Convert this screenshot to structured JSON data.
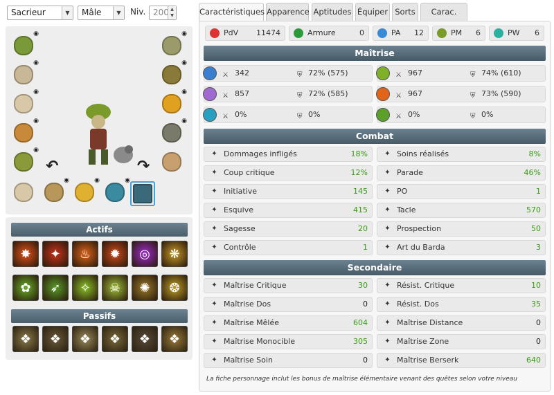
{
  "filters": {
    "class": "Sacrieur",
    "gender": "Mâle",
    "level_label": "Niv.",
    "level_value": "200"
  },
  "tabs": [
    "Caractéristiques",
    "Apparence",
    "Aptitudes",
    "Équiper",
    "Sorts",
    "Carac. Supp."
  ],
  "active_tab": "Caractéristiques",
  "top_stats": [
    {
      "label": "PdV",
      "value": "11474",
      "icon": "heart-icon",
      "color": "#d33"
    },
    {
      "label": "Armure",
      "value": "0",
      "icon": "armor-heart-icon",
      "color": "#2a9a3a"
    },
    {
      "label": "PA",
      "value": "12",
      "icon": "star-icon",
      "color": "#3a8ad8"
    },
    {
      "label": "PM",
      "value": "6",
      "icon": "boot-icon",
      "color": "#7a9a2a"
    },
    {
      "label": "PW",
      "value": "6",
      "icon": "wakfu-icon",
      "color": "#2ab0a0"
    }
  ],
  "mastery_title": "Maîtrise",
  "mastery": [
    {
      "element": "water",
      "color": "#3a7fd0",
      "mastery": "342",
      "resist": "72% (575)"
    },
    {
      "element": "earth",
      "color": "#7fb02a",
      "mastery": "967",
      "resist": "74% (610)"
    },
    {
      "element": "air",
      "color": "#a06ad0",
      "mastery": "857",
      "resist": "72% (585)"
    },
    {
      "element": "fire",
      "color": "#e0641a",
      "mastery": "967",
      "resist": "73% (590)"
    },
    {
      "element": "stasis",
      "color": "#2aa0c0",
      "mastery": "0%",
      "resist": "0%"
    },
    {
      "element": "nature",
      "color": "#5aa02a",
      "mastery": "0%",
      "resist": "0%"
    }
  ],
  "combat_title": "Combat",
  "combat": [
    {
      "label": "Dommages infligés",
      "value": "18%",
      "green": true,
      "icon": "sword-icon"
    },
    {
      "label": "Soins réalisés",
      "value": "8%",
      "green": true,
      "icon": "heal-icon"
    },
    {
      "label": "Coup critique",
      "value": "12%",
      "green": true,
      "icon": "crit-icon"
    },
    {
      "label": "Parade",
      "value": "46%",
      "green": true,
      "icon": "parry-icon"
    },
    {
      "label": "Initiative",
      "value": "145",
      "green": true,
      "icon": "initiative-icon"
    },
    {
      "label": "PO",
      "value": "1",
      "green": true,
      "icon": "range-icon"
    },
    {
      "label": "Esquive",
      "value": "415",
      "green": true,
      "icon": "dodge-icon"
    },
    {
      "label": "Tacle",
      "value": "570",
      "green": true,
      "icon": "lock-icon"
    },
    {
      "label": "Sagesse",
      "value": "20",
      "green": true,
      "icon": "wisdom-icon"
    },
    {
      "label": "Prospection",
      "value": "50",
      "green": true,
      "icon": "prospection-icon"
    },
    {
      "label": "Contrôle",
      "value": "1",
      "green": true,
      "icon": "control-icon"
    },
    {
      "label": "Art du Barda",
      "value": "3",
      "green": true,
      "icon": "bag-icon"
    }
  ],
  "secondary_title": "Secondaire",
  "secondary": [
    {
      "label": "Maîtrise Critique",
      "value": "30",
      "green": true,
      "icon": "crit-mastery-icon"
    },
    {
      "label": "Résist. Critique",
      "value": "10",
      "green": true,
      "icon": "crit-resist-icon"
    },
    {
      "label": "Maîtrise Dos",
      "value": "0",
      "green": false,
      "icon": "back-mastery-icon"
    },
    {
      "label": "Résist. Dos",
      "value": "35",
      "green": true,
      "icon": "back-resist-icon"
    },
    {
      "label": "Maîtrise Mêlée",
      "value": "604",
      "green": true,
      "icon": "melee-icon"
    },
    {
      "label": "Maîtrise Distance",
      "value": "0",
      "green": false,
      "icon": "distance-icon"
    },
    {
      "label": "Maîtrise Monocible",
      "value": "305",
      "green": true,
      "icon": "single-target-icon"
    },
    {
      "label": "Maîtrise Zone",
      "value": "0",
      "green": false,
      "icon": "area-icon"
    },
    {
      "label": "Maîtrise Soin",
      "value": "0",
      "green": false,
      "icon": "heal-mastery-icon"
    },
    {
      "label": "Maîtrise Berserk",
      "value": "640",
      "green": true,
      "icon": "berserk-icon"
    }
  ],
  "footnote": "La fiche personnage inclut les bonus de maîtrise élémentaire venant des quêtes selon votre niveau",
  "skills": {
    "active_title": "Actifs",
    "passive_title": "Passifs",
    "active_colors": [
      "#e0521a",
      "#c8321a",
      "#e0641a",
      "#d04a1a",
      "#a02ad0",
      "#c89a2a",
      "#6ab02a",
      "#5a9a2a",
      "#8ac02a",
      "#a0c03a",
      "#9a7a2a",
      "#c0a02a"
    ],
    "passive_colors": [
      "#8a7a4a",
      "#6a5a3a",
      "#9a8a5a",
      "#7a6a3a",
      "#5a4a3a",
      "#9a7a3a"
    ]
  },
  "equipment_colors": [
    "#7a9a3a",
    "#c8b898",
    "#d8c8a8",
    "#c88a3a",
    "#8a9a3a",
    "#9a9a6a",
    "#8a7a3a",
    "#e0a020",
    "#7a7a6a",
    "#c8a070",
    "#d8c8a8",
    "#b8985a",
    "#e0b030",
    "#3a8aa0"
  ]
}
